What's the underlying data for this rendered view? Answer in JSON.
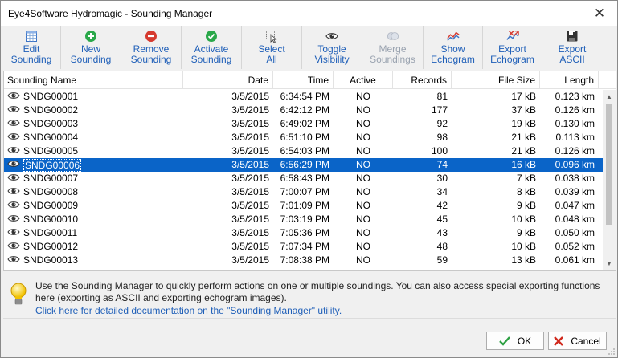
{
  "window": {
    "title": "Eye4Software Hydromagic - Sounding Manager",
    "close_label": "✕"
  },
  "toolbar": [
    {
      "label": "Edit\nSounding",
      "icon": "table-icon",
      "enabled": true
    },
    {
      "label": "New\nSounding",
      "icon": "add-icon",
      "enabled": true
    },
    {
      "label": "Remove\nSounding",
      "icon": "remove-icon",
      "enabled": true
    },
    {
      "label": "Activate\nSounding",
      "icon": "check-icon",
      "enabled": true
    },
    {
      "label": "Select\nAll",
      "icon": "select-all-icon",
      "enabled": true
    },
    {
      "label": "Toggle\nVisibility",
      "icon": "eye-icon",
      "enabled": true
    },
    {
      "label": "Merge\nSoundings",
      "icon": "merge-icon",
      "enabled": false
    },
    {
      "label": "Show\nEchogram",
      "icon": "echogram-icon",
      "enabled": true
    },
    {
      "label": "Export\nEchogram",
      "icon": "export-echogram-icon",
      "enabled": true
    },
    {
      "label": "Export\nASCII",
      "icon": "save-icon",
      "enabled": true
    }
  ],
  "table": {
    "columns": [
      "Sounding Name",
      "Date",
      "Time",
      "Active",
      "Records",
      "File Size",
      "Length"
    ],
    "selected_index": 5,
    "rows": [
      [
        "SNDG00001",
        "3/5/2015",
        "6:34:54 PM",
        "NO",
        "81",
        "17 kB",
        "0.123 km"
      ],
      [
        "SNDG00002",
        "3/5/2015",
        "6:42:12 PM",
        "NO",
        "177",
        "37 kB",
        "0.126 km"
      ],
      [
        "SNDG00003",
        "3/5/2015",
        "6:49:02 PM",
        "NO",
        "92",
        "19 kB",
        "0.130 km"
      ],
      [
        "SNDG00004",
        "3/5/2015",
        "6:51:10 PM",
        "NO",
        "98",
        "21 kB",
        "0.113 km"
      ],
      [
        "SNDG00005",
        "3/5/2015",
        "6:54:03 PM",
        "NO",
        "100",
        "21 kB",
        "0.126 km"
      ],
      [
        "SNDG00006",
        "3/5/2015",
        "6:56:29 PM",
        "NO",
        "74",
        "16 kB",
        "0.096 km"
      ],
      [
        "SNDG00007",
        "3/5/2015",
        "6:58:43 PM",
        "NO",
        "30",
        "7 kB",
        "0.038 km"
      ],
      [
        "SNDG00008",
        "3/5/2015",
        "7:00:07 PM",
        "NO",
        "34",
        "8 kB",
        "0.039 km"
      ],
      [
        "SNDG00009",
        "3/5/2015",
        "7:01:09 PM",
        "NO",
        "42",
        "9 kB",
        "0.047 km"
      ],
      [
        "SNDG00010",
        "3/5/2015",
        "7:03:19 PM",
        "NO",
        "45",
        "10 kB",
        "0.048 km"
      ],
      [
        "SNDG00011",
        "3/5/2015",
        "7:05:36 PM",
        "NO",
        "43",
        "9 kB",
        "0.050 km"
      ],
      [
        "SNDG00012",
        "3/5/2015",
        "7:07:34 PM",
        "NO",
        "48",
        "10 kB",
        "0.052 km"
      ],
      [
        "SNDG00013",
        "3/5/2015",
        "7:08:38 PM",
        "NO",
        "59",
        "13 kB",
        "0.061 km"
      ]
    ]
  },
  "info": {
    "text": "Use the Sounding Manager to quickly perform actions on one or multiple soundings. You can also access special exporting functions here (exporting as ASCII and exporting echogram images).",
    "link": "Click here for detailed documentation on the \"Sounding Manager\" utility."
  },
  "buttons": {
    "ok": "OK",
    "cancel": "Cancel"
  },
  "colors": {
    "accent": "#1f5fb8",
    "selection": "#0a64c8",
    "disabled": "#9aa3b0"
  }
}
